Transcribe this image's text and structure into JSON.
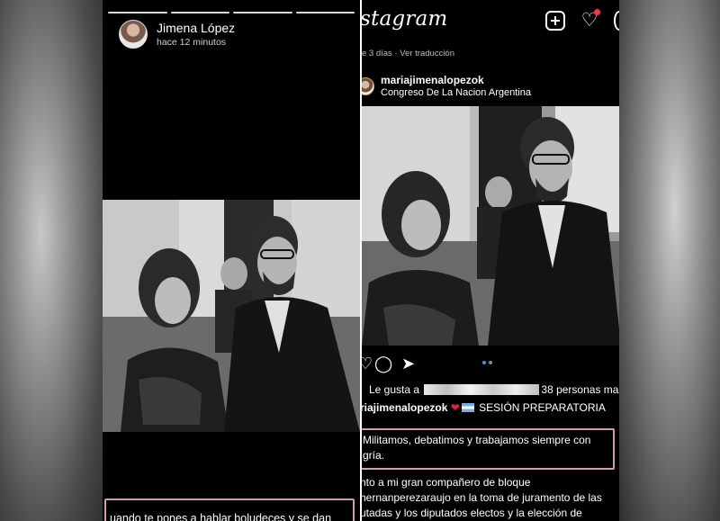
{
  "story": {
    "author_name": "Jimena López",
    "time_ago": "hace 12 minutos",
    "caption": "uando te pones a hablar boludeces y se dan"
  },
  "instagram": {
    "logo": "stagram",
    "header_icons": [
      "new-post-icon",
      "heart-icon",
      "messenger-icon"
    ],
    "date_line": "e 3 días · Ver traducción",
    "username": "mariajimenalopezok",
    "location": "Congreso De La Nacion Argentina",
    "likes_prefix": "Le gusta a",
    "likes_suffix": "38 personas ma",
    "caption_user": "riajimenalopezok",
    "caption_title": "SESIÓN PREPARATORIA",
    "highlight_text": "Militamos, debatimos y trabajamos siempre con\ngría.",
    "body_text": "nto a mi gran compañero de bloque\nhernanperezaraujo en la toma de juramento de las\nutadas y los diputados electos y la elección de"
  },
  "colors": {
    "highlight_border": "#d79aa6",
    "notification_dot": "#ff3040",
    "carousel_active": "#3897f0"
  }
}
